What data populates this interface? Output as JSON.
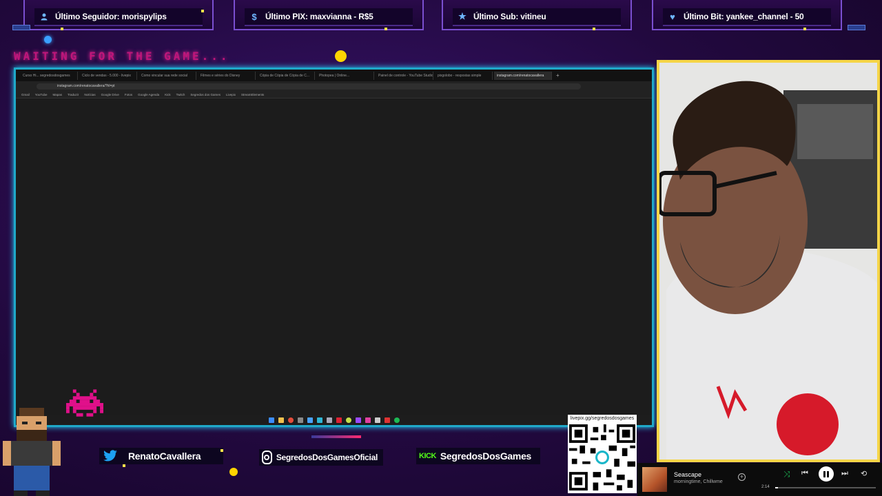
{
  "alerts": [
    {
      "icon": "user-icon",
      "text": "Último Seguidor: morispylips"
    },
    {
      "icon": "dollar-icon",
      "text": "Último PIX: maxvianna - R$5"
    },
    {
      "icon": "star-icon",
      "text": "Último Sub: vitineu"
    },
    {
      "icon": "heart-icon",
      "text": "Último Bit: yankee_channel - 50"
    }
  ],
  "waiting_text": "WAITING FOR THE GAME...",
  "browser": {
    "tabs": [
      "Curso Hi... segredosdosgames",
      "Ciclo de vendas - 5.000 - livepix",
      "Como vincular sua rede social",
      "Filmes e séries do Disney",
      "Cópia de Cópia de Cópia de C...",
      "Photopea | Online...",
      "Painel de controle - YouTube Studio",
      "pixgolobo - respostas simple",
      "instagram.com/renatocavallera"
    ],
    "address": "instagram.com/renatocavallera/?hl=pt",
    "bookmarks": [
      "Gmail",
      "YouTube",
      "Mapas",
      "Traduzir",
      "Notícias",
      "Google Drive",
      "Fotos",
      "Google Agenda",
      "Kick",
      "Twitch",
      "Segredos dos Games",
      "Livepix",
      "StreamElements"
    ]
  },
  "socials": [
    {
      "icon": "twitter-icon",
      "text": "RenatoCavallera"
    },
    {
      "icon": "instagram-icon",
      "text": "SegredosDosGamesOficial"
    },
    {
      "icon": "kick-icon",
      "badge": "KICK",
      "text": "SegredosDosGames"
    }
  ],
  "qr": {
    "label": "livepix.gg/segredosdosgames"
  },
  "player": {
    "title": "Seascape",
    "artist": "morningtime, Chillwme",
    "time": "2:14",
    "progress": 0.03
  },
  "colors": {
    "frame": "#1fa9c9",
    "cam_border": "#f5d547",
    "waiting": "#c0167a"
  }
}
